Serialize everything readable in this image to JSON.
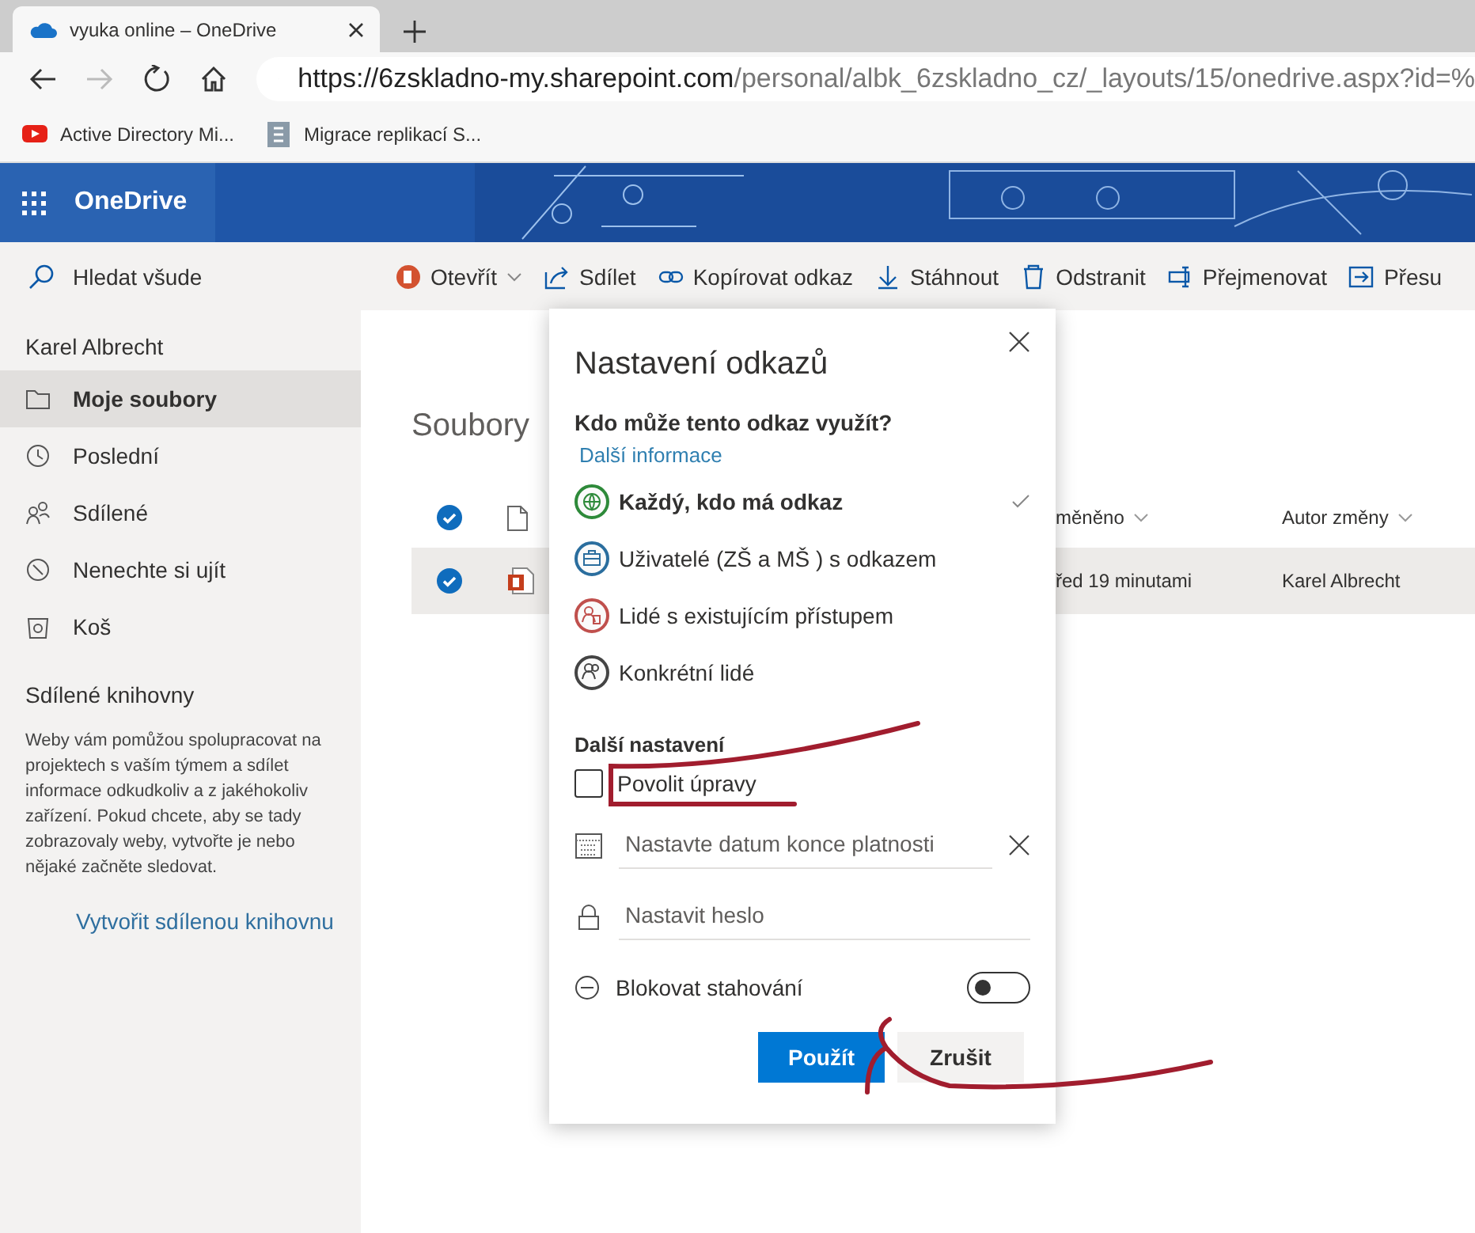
{
  "browser": {
    "tab_title": "vyuka online – OneDrive",
    "url_host": "https://6zskladno-my.sharepoint.com",
    "url_path": "/personal/albk_6zskladno_cz/_layouts/15/onedrive.aspx?id=%",
    "bookmarks": [
      {
        "label": "Active Directory Mi...",
        "kind": "video"
      },
      {
        "label": "Migrace replikací S...",
        "kind": "doc"
      }
    ]
  },
  "app": {
    "name": "OneDrive"
  },
  "search": {
    "placeholder": "Hledat všude"
  },
  "commands": [
    {
      "label": "Otevřít",
      "kind": "open",
      "dropdown": true
    },
    {
      "label": "Sdílet",
      "kind": "share",
      "dropdown": false
    },
    {
      "label": "Kopírovat odkaz",
      "kind": "link",
      "dropdown": false
    },
    {
      "label": "Stáhnout",
      "kind": "download",
      "dropdown": false
    },
    {
      "label": "Odstranit",
      "kind": "delete",
      "dropdown": false
    },
    {
      "label": "Přejmenovat",
      "kind": "rename",
      "dropdown": false
    },
    {
      "label": "Přesu",
      "kind": "move",
      "dropdown": false
    }
  ],
  "sidebar": {
    "user": "Karel Albrecht",
    "items": [
      {
        "label": "Moje soubory",
        "kind": "folder",
        "selected": true
      },
      {
        "label": "Poslední",
        "kind": "recent",
        "selected": false
      },
      {
        "label": "Sdílené",
        "kind": "shared",
        "selected": false
      },
      {
        "label": "Nenechte si ujít",
        "kind": "discover",
        "selected": false
      },
      {
        "label": "Koš",
        "kind": "bin",
        "selected": false
      }
    ],
    "section_title": "Sdílené knihovny",
    "description": "Weby vám pomůžou spolupracovat na projektech s vaším týmem a sdílet informace odkudkoliv a z jakéhokoliv zařízení. Pokud chcete, aby se tady zobrazovaly weby, vytvořte je nebo nějaké začněte sledovat.",
    "link": "Vytvořit sdílenou knihovnu"
  },
  "breadcrumb": "Soubory",
  "table": {
    "header_checked": true,
    "columns": [
      {
        "label": "měněno"
      },
      {
        "label": "Autor změny"
      }
    ],
    "rows": [
      {
        "checked": true,
        "selected": true,
        "column_1": "řed 19 minutami",
        "column_2": "Karel Albrecht"
      }
    ]
  },
  "dialog": {
    "title": "Nastavení odkazů",
    "question": "Kdo může tento odkaz využít?",
    "info_link": "Další informace",
    "options": [
      {
        "label": "Každý, kdo má odkaz",
        "kind": "anyone",
        "color": "#2e8a3a",
        "selected": true
      },
      {
        "label": "Uživatelé (ZŠ a MŠ ) s odkazem",
        "kind": "organization",
        "color": "#2b6e9e",
        "selected": false
      },
      {
        "label": "Lidé s existujícím přístupem",
        "kind": "existing",
        "color": "#c0504d",
        "selected": false
      },
      {
        "label": "Konkrétní lidé",
        "kind": "specific",
        "color": "#444444",
        "selected": false
      }
    ],
    "more_title": "Další nastavení",
    "allow_edit": {
      "label": "Povolit úpravy",
      "checked": false
    },
    "expiry": {
      "placeholder": "Nastavte datum konce platnosti"
    },
    "password": {
      "placeholder": "Nastavit heslo"
    },
    "block_download": {
      "label": "Blokovat stahování",
      "on": false
    },
    "buttons": [
      {
        "label": "Použít",
        "kind": "primary"
      },
      {
        "label": "Zrušit",
        "kind": "secondary"
      }
    ]
  }
}
